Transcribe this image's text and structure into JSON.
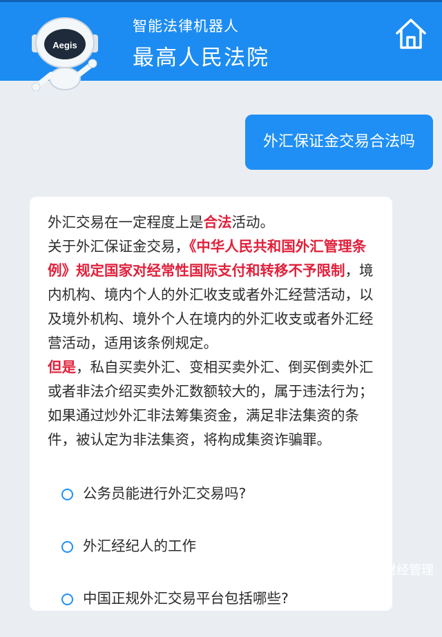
{
  "header": {
    "subtitle": "智能法律机器人",
    "title": "最高人民法院",
    "robot_badge": "Aegis",
    "home_icon": "home-icon",
    "colors": {
      "bar": "#1c8cf2"
    }
  },
  "chat": {
    "user_question": "外汇保证金交易合法吗",
    "answer": {
      "p1_a": "外汇交易在一定程度上是",
      "p1_hl": "合法",
      "p1_b": "活动。",
      "p2_a": "关于外汇保证金交易，",
      "p2_hl": "《中华人民共和国外汇管理条例》规定国家对经常性国际支付和转移不予限制",
      "p2_b": "，境内机构、境内个人的外汇收支或者外汇经营活动，以及境外机构、境外个人在境内的外汇收支或者外汇经营活动，适用该条例规定。",
      "p3_hl": "但是",
      "p3_b": "，私自买卖外汇、变相买卖外汇、倒买倒卖外汇或者非法介绍买卖外汇数额较大的，属于违法行为；如果通过炒外汇非法筹集资金，满足非法集资的条件，被认定为非法集资，将构成集资诈骗罪。",
      "highlight_color": "#e0203b"
    },
    "suggestions": [
      "公务员能进行外汇交易吗?",
      "外汇经纪人的工作",
      "中国正规外汇交易平台包括哪些?"
    ]
  },
  "watermark": {
    "text": "财经管理",
    "icon": "wechat-icon"
  }
}
